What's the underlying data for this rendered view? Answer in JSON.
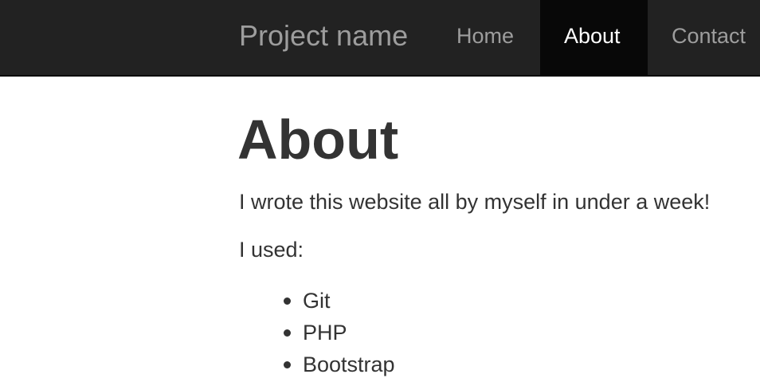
{
  "navbar": {
    "brand": "Project name",
    "items": [
      {
        "label": "Home",
        "active": false
      },
      {
        "label": "About",
        "active": true
      },
      {
        "label": "Contact",
        "active": false
      }
    ],
    "colors": {
      "background": "#222222",
      "active_background": "#080808",
      "text": "#9d9d9d",
      "active_text": "#ffffff"
    }
  },
  "main": {
    "title": "About",
    "paragraphs": [
      "I wrote this website all by myself in under a week!",
      "I used:"
    ],
    "tools": [
      "Git",
      "PHP",
      "Bootstrap"
    ]
  }
}
